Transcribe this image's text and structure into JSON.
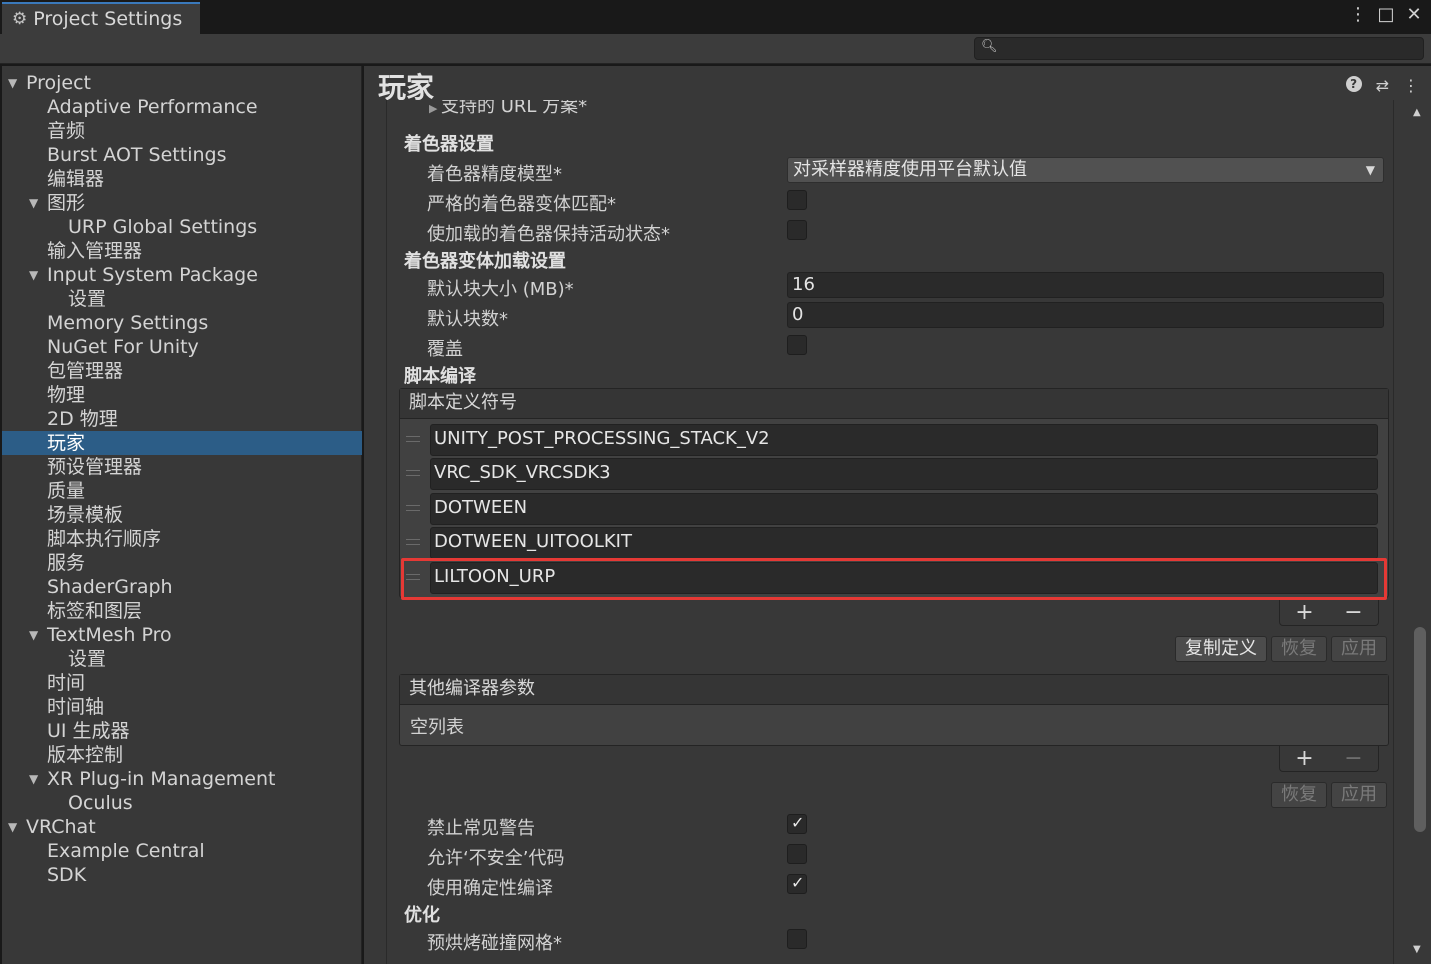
{
  "window": {
    "tab_title": "Project Settings",
    "menu_icon": "⋮",
    "maximize_icon": "□",
    "close_icon": "✕"
  },
  "search": {
    "value": "",
    "placeholder": ""
  },
  "sidebar": {
    "items": [
      {
        "label": "Project",
        "level": 0,
        "expanded": true
      },
      {
        "label": "Adaptive Performance",
        "level": 1
      },
      {
        "label": "音频",
        "level": 1
      },
      {
        "label": "Burst AOT Settings",
        "level": 1
      },
      {
        "label": "编辑器",
        "level": 1
      },
      {
        "label": "图形",
        "level": 1,
        "expanded": true
      },
      {
        "label": "URP Global Settings",
        "level": 2
      },
      {
        "label": "输入管理器",
        "level": 1
      },
      {
        "label": "Input System Package",
        "level": 1,
        "expanded": true
      },
      {
        "label": "设置",
        "level": 2
      },
      {
        "label": "Memory Settings",
        "level": 1
      },
      {
        "label": "NuGet For Unity",
        "level": 1
      },
      {
        "label": "包管理器",
        "level": 1
      },
      {
        "label": "物理",
        "level": 1
      },
      {
        "label": "2D 物理",
        "level": 1
      },
      {
        "label": "玩家",
        "level": 1,
        "selected": true
      },
      {
        "label": "预设管理器",
        "level": 1
      },
      {
        "label": "质量",
        "level": 1
      },
      {
        "label": "场景模板",
        "level": 1
      },
      {
        "label": "脚本执行顺序",
        "level": 1
      },
      {
        "label": "服务",
        "level": 1
      },
      {
        "label": "ShaderGraph",
        "level": 1
      },
      {
        "label": "标签和图层",
        "level": 1
      },
      {
        "label": "TextMesh Pro",
        "level": 1,
        "expanded": true
      },
      {
        "label": "设置",
        "level": 2
      },
      {
        "label": "时间",
        "level": 1
      },
      {
        "label": "时间轴",
        "level": 1
      },
      {
        "label": "UI 生成器",
        "level": 1
      },
      {
        "label": "版本控制",
        "level": 1
      },
      {
        "label": "XR Plug-in Management",
        "level": 1,
        "expanded": true
      },
      {
        "label": "Oculus",
        "level": 2
      },
      {
        "label": "VRChat",
        "level": 0,
        "expanded": true
      },
      {
        "label": "Example Central",
        "level": 1
      },
      {
        "label": "SDK",
        "level": 1
      }
    ]
  },
  "main": {
    "title": "玩家",
    "header_icons": {
      "help": "?",
      "settings": "⇄",
      "more": "⋮"
    },
    "partial_row": "支持的 URL 方案*",
    "shader_settings": {
      "section": "着色器设置",
      "precision_label": "着色器精度模型*",
      "precision_value": "对采样器精度使用平台默认值",
      "strict_label": "严格的着色器变体匹配*",
      "strict_checked": false,
      "keep_loaded_label": "使加载的着色器保持活动状态*",
      "keep_loaded_checked": false
    },
    "variant_loading": {
      "section": "着色器变体加载设置",
      "chunk_size_label": "默认块大小 (MB)*",
      "chunk_size_value": "16",
      "chunk_count_label": "默认块数*",
      "chunk_count_value": "0",
      "override_label": "覆盖",
      "override_checked": false
    },
    "script_compilation": {
      "section": "脚本编译",
      "defines_header": "脚本定义符号",
      "defines": [
        "UNITY_POST_PROCESSING_STACK_V2",
        "VRC_SDK_VRCSDK3",
        "DOTWEEN",
        "DOTWEEN_UITOOLKIT",
        "LILTOON_URP"
      ],
      "add": "+",
      "remove": "−",
      "copy_defines": "复制定义",
      "revert": "恢复",
      "apply": "应用",
      "compiler_args_header": "其他编译器参数",
      "compiler_args_empty": "空列表",
      "add2": "+",
      "remove2": "−",
      "revert2": "恢复",
      "apply2": "应用",
      "suppress_warnings_label": "禁止常见警告",
      "suppress_warnings_checked": true,
      "unsafe_label": "允许‘不安全’代码",
      "unsafe_checked": false,
      "deterministic_label": "使用确定性编译",
      "deterministic_checked": true
    },
    "optimization": {
      "section": "优化",
      "prebake_label": "预烘烤碰撞网格*",
      "prebake_checked": false
    }
  },
  "colors": {
    "selection": "#2c5d87",
    "highlight_border": "#e53935",
    "accent_tab": "#3a79bb"
  }
}
